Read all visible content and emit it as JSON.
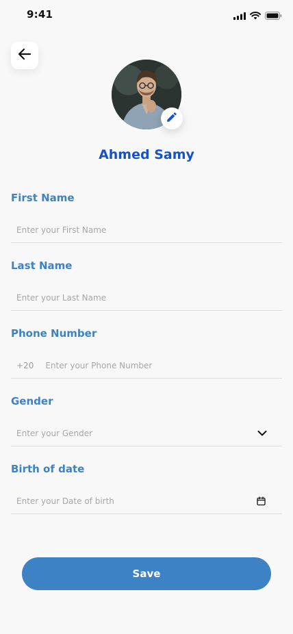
{
  "status_bar": {
    "time": "9:41",
    "icons": [
      "signal-icon",
      "wifi-icon",
      "battery-icon"
    ]
  },
  "header": {
    "back_icon": "arrow-left-icon"
  },
  "profile": {
    "name": "Ahmed Samy",
    "edit_icon": "pencil-icon"
  },
  "form": {
    "first_name": {
      "label": "First Name",
      "value": "",
      "placeholder": "Enter your First Name"
    },
    "last_name": {
      "label": "Last Name",
      "value": "",
      "placeholder": "Enter your Last Name"
    },
    "phone": {
      "label": "Phone Number",
      "prefix": "+20",
      "value": "",
      "placeholder": "Enter your Phone Number"
    },
    "gender": {
      "label": "Gender",
      "value": "",
      "placeholder": "Enter your Gender",
      "icon": "chevron-down-icon"
    },
    "birth_date": {
      "label": "Birth of date",
      "value": "",
      "placeholder": "Enter your Date of birth",
      "icon": "calendar-icon"
    }
  },
  "actions": {
    "save_label": "Save"
  },
  "colors": {
    "accent": "#3c82c5",
    "name": "#1552c9",
    "background": "#f8f8f8"
  }
}
